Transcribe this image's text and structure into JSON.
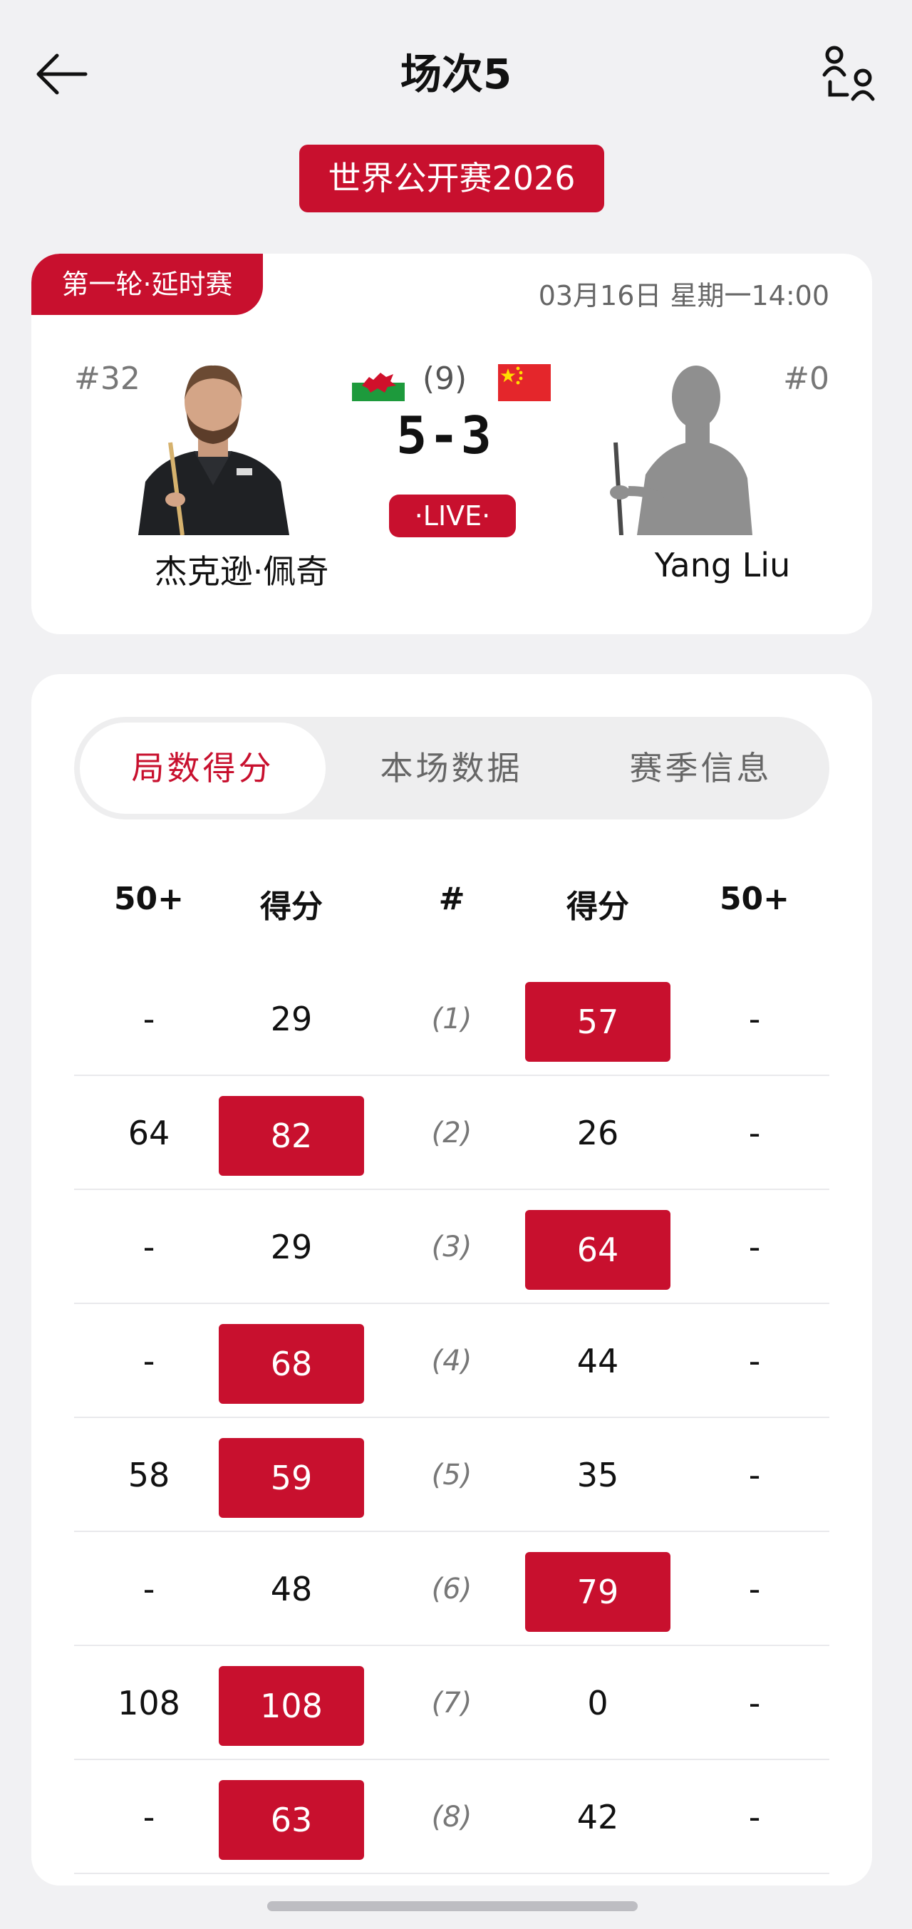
{
  "header": {
    "title": "场次5",
    "tournament": "世界公开赛2026"
  },
  "match": {
    "round": "第一轮·延时赛",
    "datetime": "03月16日 星期一14:00",
    "best_of": "(9)",
    "score": "5-3",
    "status": "·LIVE·",
    "player_left": {
      "rank": "#32",
      "name": "杰克逊·佩奇",
      "flag": "wales"
    },
    "player_right": {
      "rank": "#0",
      "name": "Yang Liu",
      "flag": "china"
    }
  },
  "tabs": [
    {
      "label": "局数得分",
      "active": true
    },
    {
      "label": "本场数据",
      "active": false
    },
    {
      "label": "赛季信息",
      "active": false
    }
  ],
  "table": {
    "headers": [
      "50+",
      "得分",
      "#",
      "得分",
      "50+"
    ],
    "rows": [
      {
        "left_break": "-",
        "left_score": "29",
        "frame": "(1)",
        "right_score": "57",
        "right_break": "-",
        "winner": "right"
      },
      {
        "left_break": "64",
        "left_score": "82",
        "frame": "(2)",
        "right_score": "26",
        "right_break": "-",
        "winner": "left"
      },
      {
        "left_break": "-",
        "left_score": "29",
        "frame": "(3)",
        "right_score": "64",
        "right_break": "-",
        "winner": "right"
      },
      {
        "left_break": "-",
        "left_score": "68",
        "frame": "(4)",
        "right_score": "44",
        "right_break": "-",
        "winner": "left"
      },
      {
        "left_break": "58",
        "left_score": "59",
        "frame": "(5)",
        "right_score": "35",
        "right_break": "-",
        "winner": "left"
      },
      {
        "left_break": "-",
        "left_score": "48",
        "frame": "(6)",
        "right_score": "79",
        "right_break": "-",
        "winner": "right"
      },
      {
        "left_break": "108",
        "left_score": "108",
        "frame": "(7)",
        "right_score": "0",
        "right_break": "-",
        "winner": "left"
      },
      {
        "left_break": "-",
        "left_score": "63",
        "frame": "(8)",
        "right_score": "42",
        "right_break": "-",
        "winner": "left"
      }
    ]
  },
  "colors": {
    "accent": "#c8102e",
    "background": "#f1f1f3"
  }
}
